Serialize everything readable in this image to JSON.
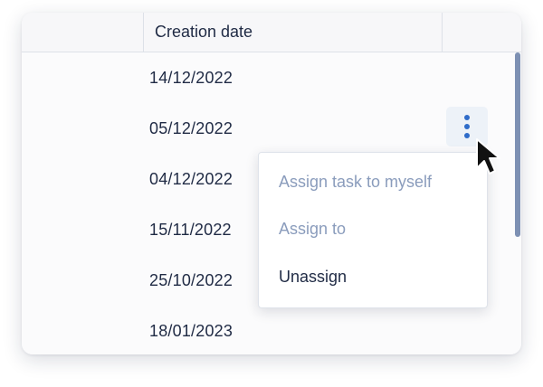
{
  "table": {
    "columns": [
      "",
      "Creation date",
      ""
    ],
    "rows": [
      {
        "creation_date": "14/12/2022"
      },
      {
        "creation_date": "05/12/2022"
      },
      {
        "creation_date": "04/12/2022"
      },
      {
        "creation_date": "15/11/2022"
      },
      {
        "creation_date": "25/10/2022"
      },
      {
        "creation_date": "18/01/2023"
      }
    ]
  },
  "context_menu": {
    "items": [
      {
        "label": "Assign task to myself",
        "state": "disabled"
      },
      {
        "label": "Assign to",
        "state": "disabled"
      },
      {
        "label": "Unassign",
        "state": "enabled"
      }
    ]
  },
  "icons": {
    "row_actions": "vertical-ellipsis-icon",
    "pointer": "mouse-pointer-icon"
  },
  "colors": {
    "accent": "#2f6cc9",
    "disabled_text": "#8a9cbc",
    "text": "#1f2a44",
    "scrollbar": "#7d90b3"
  }
}
